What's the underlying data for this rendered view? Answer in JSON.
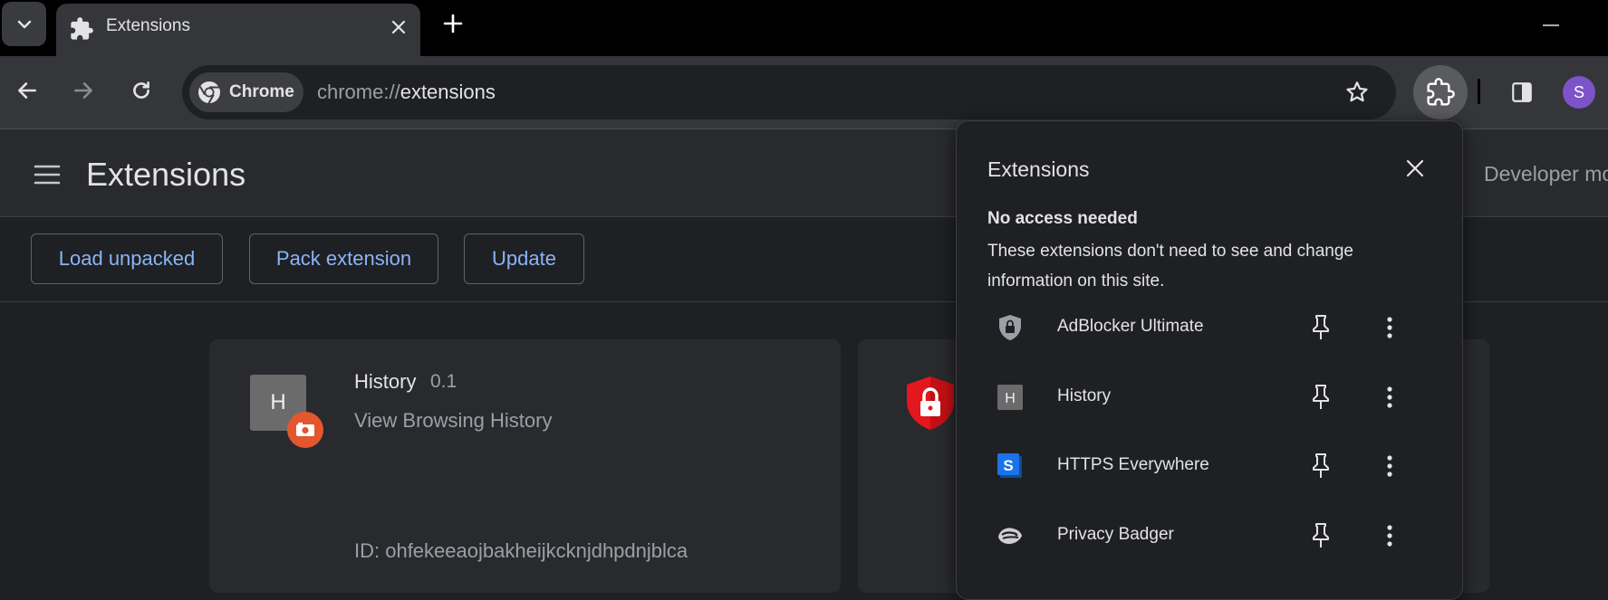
{
  "tab": {
    "title": "Extensions",
    "icon": "puzzle-icon"
  },
  "omnibox": {
    "chip_label": "Chrome",
    "url_scheme": "chrome://",
    "url_path": "extensions"
  },
  "profile": {
    "initial": "S",
    "color": "#7c53c9"
  },
  "page": {
    "title": "Extensions",
    "developer_mode_label": "Developer mo"
  },
  "actions": {
    "load_unpacked": "Load unpacked",
    "pack_extension": "Pack extension",
    "update": "Update"
  },
  "cards": {
    "history": {
      "icon_letter": "H",
      "name": "History",
      "version": "0.1",
      "description": "View Browsing History",
      "id_text": "ID: ohfekeeaojbakheijkcknjdhpdnjblca"
    }
  },
  "popup": {
    "title": "Extensions",
    "section_title": "No access needed",
    "section_desc": "These extensions don't need to see and change information on this site.",
    "items": [
      {
        "name": "AdBlocker Ultimate",
        "icon": "shield-lock-icon"
      },
      {
        "name": "History",
        "icon": "history-h-icon"
      },
      {
        "name": "HTTPS Everywhere",
        "icon": "https-everywhere-icon"
      },
      {
        "name": "Privacy Badger",
        "icon": "badger-icon"
      }
    ]
  },
  "colors": {
    "accent_link": "#8ab4f8",
    "toolbar_bg": "#35363a",
    "page_bg": "#1f2023"
  }
}
